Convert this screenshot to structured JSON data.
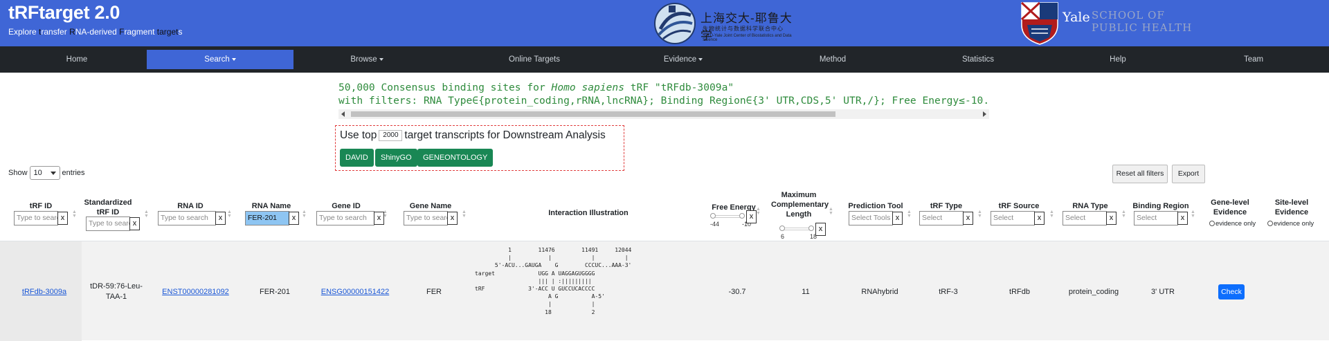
{
  "header": {
    "title": "tRFtarget 2.0",
    "subtitle_parts": [
      {
        "text": "Explore ",
        "hl": false
      },
      {
        "text": "t",
        "hl": true
      },
      {
        "text": "ransfer ",
        "hl": false
      },
      {
        "text": "R",
        "hl": true
      },
      {
        "text": "NA-derived ",
        "hl": false
      },
      {
        "text": "F",
        "hl": true
      },
      {
        "text": "ragment ",
        "hl": false
      },
      {
        "text": "target",
        "hl": true
      },
      {
        "text": "s",
        "hl": false
      }
    ],
    "partner1_name_cn": "上海交大-耶鲁大学",
    "partner1_sub_cn": "生物统计与数据科学联合中心",
    "partner1_sub_en": "SJTU-Yale Joint Center of Biostatistics and Data Science",
    "partner2_name": "Yale",
    "partner2_school_line1": "SCHOOL OF",
    "partner2_school_line2": "PUBLIC HEALTH"
  },
  "nav": {
    "items": [
      {
        "label": "Home",
        "active": false,
        "dropdown": false
      },
      {
        "label": "Search",
        "active": true,
        "dropdown": true
      },
      {
        "label": "Browse",
        "active": false,
        "dropdown": true
      },
      {
        "label": "Online Targets",
        "active": false,
        "dropdown": false
      },
      {
        "label": "Evidence",
        "active": false,
        "dropdown": true
      },
      {
        "label": "Method",
        "active": false,
        "dropdown": false
      },
      {
        "label": "Statistics",
        "active": false,
        "dropdown": false
      },
      {
        "label": "Help",
        "active": false,
        "dropdown": false
      },
      {
        "label": "Team",
        "active": false,
        "dropdown": false
      }
    ]
  },
  "summary": {
    "count": "50,000",
    "line1_a": "Consensus binding sites for",
    "species": "Homo sapiens",
    "line1_b": "tRF \"tRFdb-3009a\"",
    "line2": "with filters: RNA Type∈{protein_coding,rRNA,lncRNA}; Binding Region∈{3' UTR,CDS,5' UTR,/}; Free Energy≤-10."
  },
  "downstream": {
    "label_pre": "Use top",
    "top_value": "2000",
    "label_post": "target transcripts for Downstream Analysis",
    "buttons": [
      "DAVID",
      "ShinyGO",
      "GENEONTOLOGY"
    ]
  },
  "table_controls": {
    "show_label": "Show",
    "entries_value": "10",
    "entries_label": "entries",
    "reset_label": "Reset all filters",
    "export_label": "Export"
  },
  "columns": {
    "trf_id": "tRF ID",
    "std_trf_id": "Standardized tRF ID",
    "rna_id": "RNA ID",
    "rna_name": "RNA Name",
    "gene_id": "Gene ID",
    "gene_name": "Gene Name",
    "illustration": "Interaction Illustration",
    "free_energy": "Free Energy",
    "max_comp_len": "Maximum Complementary Length",
    "pred_tool": "Prediction Tool",
    "trf_type": "tRF Type",
    "trf_source": "tRF Source",
    "rna_type": "RNA Type",
    "binding_region": "Binding Region",
    "gene_evidence": "Gene-level Evidence",
    "site_evidence": "Site-level Evidence"
  },
  "filters": {
    "search_placeholder": "Type to search",
    "rna_name_value": "FER-201",
    "select_tools": "Select Tools",
    "select": "Select",
    "clear": "x",
    "free_energy_min": "-44",
    "free_energy_max": "-10",
    "comp_len_min": "6",
    "comp_len_max": "18",
    "evidence_only": "evidence only"
  },
  "row": {
    "trf_id": "tRFdb-3009a",
    "std_trf_id": "tDR-59:76-Leu-TAA-1",
    "rna_id": "ENST00000281092",
    "rna_name": "FER-201",
    "gene_id": "ENSG00000151422",
    "gene_name": "FER",
    "free_energy": "-30.7",
    "max_comp_len": "11",
    "pred_tool": "RNAhybrid",
    "trf_type": "tRF-3",
    "trf_source": "tRFdb",
    "rna_type": "protein_coding",
    "binding_region": "3' UTR",
    "check_label": "Check",
    "illustration": "          1        11476        11491     12044\n          |           |            |         |\n      5'-ACU...GAUGA    G        CCCUC...AAA-3'\ntarget             UGG A UAGGAGUGGGG\n                   ||| | :|||||||||\ntRF             3'-ACC U GUCCUCACCCC\n                      A G          A-5'\n                      |            |\n                     18            2"
  }
}
